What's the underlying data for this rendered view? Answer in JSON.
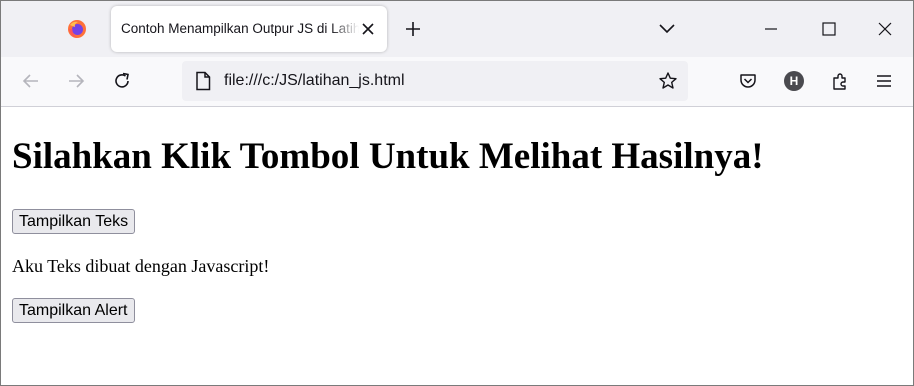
{
  "browser": {
    "tab": {
      "title": "Contoh Menampilkan Outpur JS di Latihan"
    },
    "address_bar": {
      "url": "file:///c:/JS/latihan_js.html"
    },
    "profile_initial": "H",
    "icons": {
      "logo": "firefox-logo-icon",
      "tab_close": "close-icon",
      "new_tab": "plus-icon",
      "list_tabs": "chevron-down-icon",
      "minimize": "minimize-icon",
      "maximize": "maximize-icon",
      "close": "close-icon",
      "back": "arrow-left-icon",
      "forward": "arrow-right-icon",
      "reload": "reload-icon",
      "file": "file-icon",
      "bookmark": "star-icon",
      "pocket": "pocket-icon",
      "extensions": "puzzle-icon",
      "menu": "hamburger-menu-icon"
    }
  },
  "page": {
    "heading": "Silahkan Klik Tombol Untuk Melihat Hasilnya!",
    "show_text_button": "Tampilkan Teks",
    "output_text": "Aku Teks dibuat dengan Javascript!",
    "show_alert_button": "Tampilkan Alert"
  },
  "colors": {
    "tabstrip_bg": "#f0f0f4",
    "navbar_bg": "#f9f9fb",
    "urlbar_bg": "#f0f0f4",
    "button_bg": "#e9e9ed"
  }
}
